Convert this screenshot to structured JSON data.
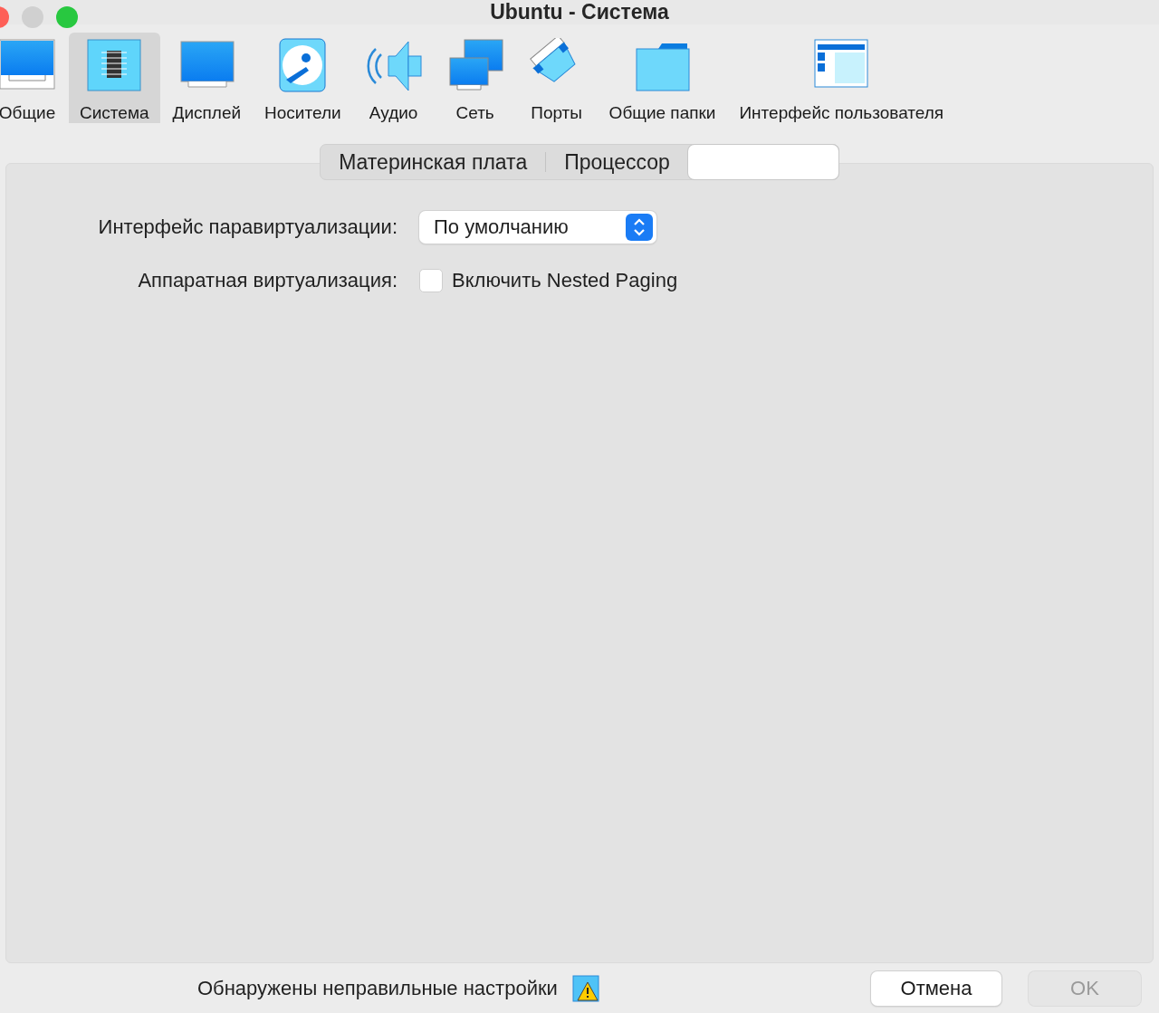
{
  "window": {
    "title": "Ubuntu - Система"
  },
  "toolbar": [
    {
      "kind": "general",
      "label": "Общие",
      "selected": false
    },
    {
      "kind": "system",
      "label": "Система",
      "selected": true
    },
    {
      "kind": "display",
      "label": "Дисплей",
      "selected": false
    },
    {
      "kind": "storage",
      "label": "Носители",
      "selected": false
    },
    {
      "kind": "audio",
      "label": "Аудио",
      "selected": false
    },
    {
      "kind": "network",
      "label": "Сеть",
      "selected": false
    },
    {
      "kind": "ports",
      "label": "Порты",
      "selected": false
    },
    {
      "kind": "shared",
      "label": "Общие папки",
      "selected": false
    },
    {
      "kind": "ui",
      "label": "Интерфейс пользователя",
      "selected": false
    }
  ],
  "tabs": [
    {
      "label": "Материнская плата",
      "selected": false
    },
    {
      "label": "Процессор",
      "selected": false
    },
    {
      "selected": true
    }
  ],
  "form": {
    "paravirt_label": "Интерфейс паравиртуализации:",
    "paravirt_value": "По умолчанию",
    "hwvirt_label": "Аппаратная виртуализация:",
    "nested_paging": {
      "label": "Включить Nested Paging",
      "checked": false
    }
  },
  "footer": {
    "warning": "Обнаружены неправильные настройки",
    "buttons": [
      {
        "label": "Отмена",
        "disabled": false
      },
      {
        "label": "OK",
        "disabled": true
      }
    ]
  }
}
